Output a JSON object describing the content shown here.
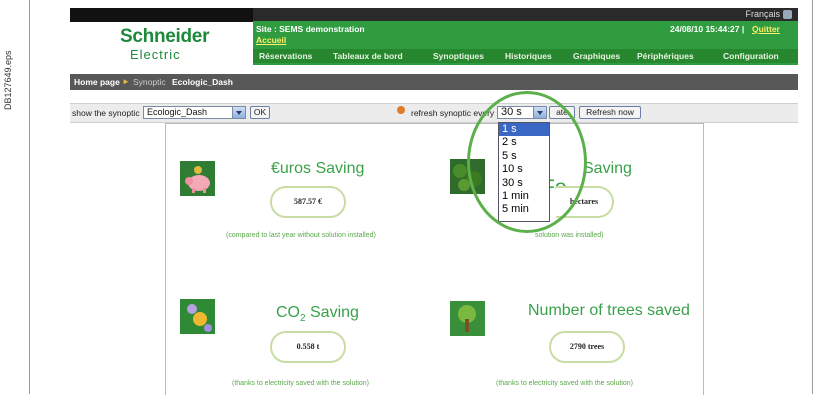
{
  "side_label": "DB127649.eps",
  "header": {
    "brand_line1": "Schneider",
    "brand_line2": "Electric",
    "language": "Français",
    "site": "Site : SEMS demonstration",
    "accueil": "Accueil",
    "datetime": "24/08/10 15:44:27",
    "separator": "|",
    "quit": "Quitter",
    "nav": [
      "Réservations",
      "Tableaux de bord",
      "Synoptiques",
      "Historiques",
      "Graphiques",
      "Périphériques",
      "Configuration"
    ]
  },
  "breadcrumb": {
    "home": "Home page",
    "arrow": "►",
    "synoptic": "Synoptic",
    "current": "Ecologic_Dash"
  },
  "toolbar": {
    "show_label": "show the synoptic",
    "synoptic_value": "Ecologic_Dash",
    "ok_label": "OK",
    "refresh_label": "refresh synoptic every",
    "refresh_value": "30 s",
    "update_partial": "ate",
    "refresh_now_label": "Refresh now"
  },
  "refresh_options": [
    "1 s",
    "2 s",
    "5 s",
    "10 s",
    "30 s",
    "1 min",
    "5 min"
  ],
  "tiles": {
    "euros": {
      "title": "€uros Saving",
      "value": "587.57 €",
      "note": "(compared to last year without solution installed)"
    },
    "forest": {
      "title_partial": "Saving",
      "overlay": "Fo",
      "value_partial": "hectares",
      "note_partial": "solution was installed)"
    },
    "co2": {
      "title_prefix": "CO",
      "title_sub": "2",
      "title_suffix": " Saving",
      "value": "0.558 t",
      "note": "(thanks to electricity saved with the solution)"
    },
    "trees": {
      "title": "Number of trees saved",
      "value": "2790 trees",
      "note": "(thanks to electricity saved with the solution)"
    }
  }
}
